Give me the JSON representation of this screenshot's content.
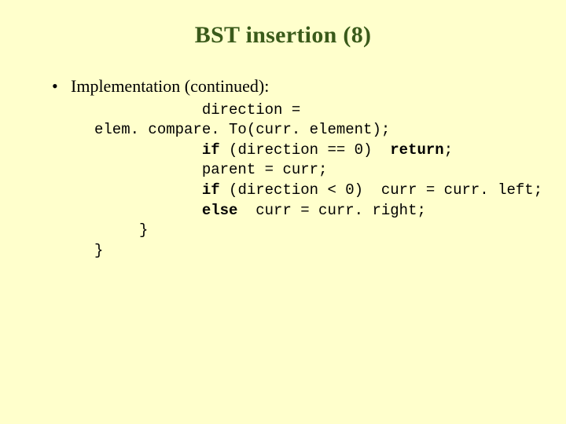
{
  "title": "BST insertion (8)",
  "bullet": "Implementation (continued):",
  "code": {
    "l1": "            direction = ",
    "l2": "elem. compare. To(curr. element);",
    "l3a": "            ",
    "l3kw": "if",
    "l3b": " (direction == 0)  ",
    "l3kw2": "return",
    "l3c": ";",
    "l4": "            parent = curr;",
    "l5a": "            ",
    "l5kw": "if",
    "l5b": " (direction < 0)  curr = curr. left;",
    "l6a": "            ",
    "l6kw": "else",
    "l6b": "  curr = curr. right;",
    "l7": "     }",
    "l8": "}"
  }
}
